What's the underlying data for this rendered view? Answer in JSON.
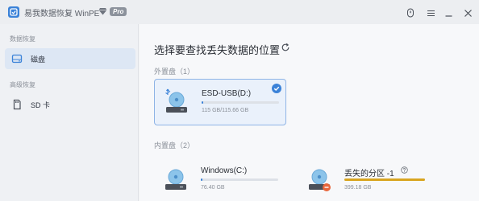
{
  "window": {
    "title": "易我数据恢复 WinPE",
    "badge": "Pro"
  },
  "sidebar": {
    "sections": [
      {
        "label": "数据恢复",
        "items": [
          {
            "label": "磁盘",
            "icon": "hard-drive-icon"
          }
        ]
      },
      {
        "label": "高级恢复",
        "items": [
          {
            "label": "SD 卡",
            "icon": "sd-card-icon"
          }
        ]
      }
    ]
  },
  "main": {
    "title": "选择要查找丢失数据的位置",
    "external_label": "外置盘（1）",
    "internal_label": "内置盘（2）",
    "external_drives": [
      {
        "name": "ESD-USB(D:)",
        "size": "115 GB/115.66 GB",
        "usage": 0.02
      }
    ],
    "internal_drives": [
      {
        "name": "Windows(C:)",
        "size": "76.40 GB",
        "usage": 0.02
      },
      {
        "name": "丢失的分区 -1",
        "size": "399.18 GB",
        "usage": 1.0
      }
    ]
  },
  "colors": {
    "accent": "#3b82d8",
    "lost_bar": "#d9a520",
    "lost_badge": "#e8663c"
  }
}
